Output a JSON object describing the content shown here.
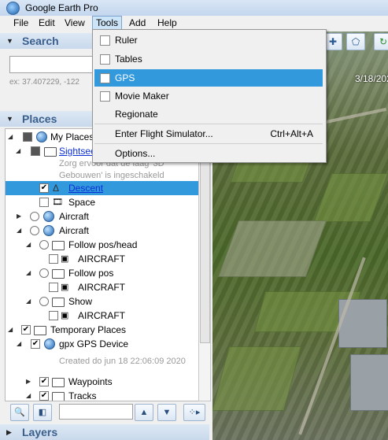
{
  "window": {
    "title": "Google Earth Pro"
  },
  "menubar": {
    "items": [
      "File",
      "Edit",
      "View",
      "Tools",
      "Add",
      "Help"
    ]
  },
  "tools_menu": {
    "items": [
      {
        "label": "Ruler",
        "checkbox": true,
        "checked": false
      },
      {
        "label": "Tables",
        "checkbox": true,
        "checked": false
      },
      {
        "label": "GPS",
        "checkbox": true,
        "checked": false,
        "highlighted": true
      },
      {
        "label": "Movie Maker",
        "checkbox": true,
        "checked": false
      },
      {
        "label": "Regionate",
        "checkbox": false
      },
      {
        "label": "Enter Flight Simulator...",
        "checkbox": false,
        "shortcut": "Ctrl+Alt+A"
      },
      {
        "label": "Options...",
        "checkbox": false
      }
    ]
  },
  "search": {
    "header": "Search",
    "placeholder": "ex: 37.407229, -122"
  },
  "places": {
    "header": "Places",
    "tree": [
      {
        "label": "My Places"
      },
      {
        "label": "Sightsee"
      },
      {
        "label": "Zorg ervoor dat de laag '3D"
      },
      {
        "label": "Gebouwen' is ingeschakeld"
      },
      {
        "label": "Descent",
        "selected": true
      },
      {
        "label": "Space"
      },
      {
        "label": "Aircraft"
      },
      {
        "label": "Aircraft"
      },
      {
        "label": "Follow pos/head"
      },
      {
        "label": "AIRCRAFT"
      },
      {
        "label": "Follow pos"
      },
      {
        "label": "AIRCRAFT"
      },
      {
        "label": "Show"
      },
      {
        "label": "AIRCRAFT"
      },
      {
        "label": "Temporary Places"
      },
      {
        "label": "gpx GPS Device"
      },
      {
        "label": "Created do jun 18 22:06:09 2020"
      },
      {
        "label": "Waypoints"
      },
      {
        "label": "Tracks"
      }
    ]
  },
  "layers": {
    "header": "Layers"
  },
  "map": {
    "date_label": "3/18/202"
  }
}
